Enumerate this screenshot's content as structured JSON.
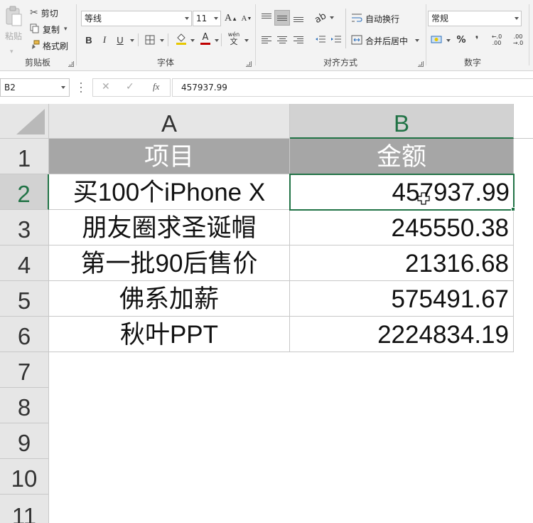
{
  "ribbon": {
    "clipboard": {
      "paste_label": "粘贴",
      "cut_label": "剪切",
      "copy_label": "复制",
      "format_painter_label": "格式刷",
      "group_label": "剪贴板"
    },
    "font": {
      "font_name": "等线",
      "font_size": "11",
      "grow_label": "A",
      "shrink_label": "A",
      "bold_label": "B",
      "italic_label": "I",
      "underline_label": "U",
      "font_color_label": "A",
      "phonetic_top": "wén",
      "phonetic_bottom": "文",
      "group_label": "字体"
    },
    "alignment": {
      "wrap_text_label": "自动换行",
      "merge_center_label": "合并后居中",
      "group_label": "对齐方式"
    },
    "number": {
      "format_value": "常规",
      "percent_label": "%",
      "comma_label": "❜",
      "inc_decimal_label": "←.0 .00",
      "dec_decimal_label": ".00 →.0",
      "group_label": "数字"
    },
    "accent_color": "#217346"
  },
  "formula_bar": {
    "name_box": "B2",
    "cancel_symbol": "✕",
    "enter_symbol": "✓",
    "fx_symbol": "fx",
    "content": "457937.99"
  },
  "sheet": {
    "columns": [
      "A",
      "B"
    ],
    "selected_column": "B",
    "row_numbers": [
      "1",
      "2",
      "3",
      "4",
      "5",
      "6",
      "7",
      "8",
      "9",
      "10",
      "11"
    ],
    "selected_row": "2",
    "header": {
      "a": "项目",
      "b": "金额"
    },
    "rows": [
      {
        "a": "买100个iPhone X",
        "b": "457937.99"
      },
      {
        "a": "朋友圈求圣诞帽",
        "b": "245550.38"
      },
      {
        "a": "第一批90后售价",
        "b": "21316.68"
      },
      {
        "a": "佛系加薪",
        "b": "575491.67"
      },
      {
        "a": "秋叶PPT",
        "b": "2224834.19"
      }
    ],
    "header_fill": "#a6a6a6",
    "selection_color": "#217346"
  }
}
